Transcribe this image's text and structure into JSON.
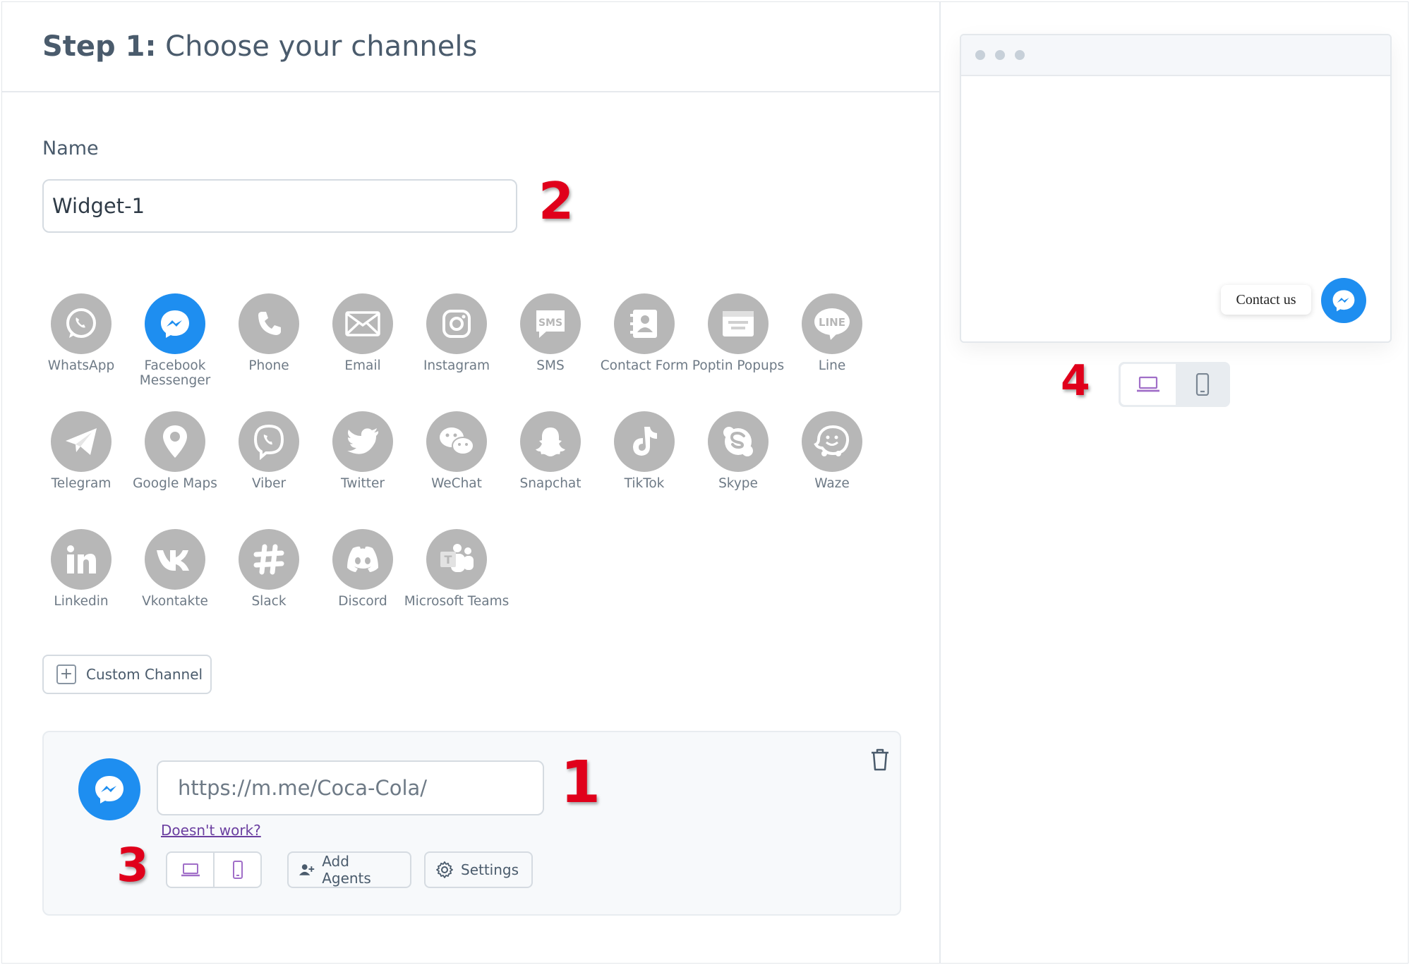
{
  "header": {
    "step_label": "Step 1:",
    "title": "Choose your channels"
  },
  "name_field": {
    "label": "Name",
    "value": "Widget-1"
  },
  "channels": [
    {
      "label": "WhatsApp",
      "icon": "whatsapp-icon"
    },
    {
      "label": "Facebook Messenger",
      "icon": "messenger-icon",
      "selected": true
    },
    {
      "label": "Phone",
      "icon": "phone-icon"
    },
    {
      "label": "Email",
      "icon": "email-icon"
    },
    {
      "label": "Instagram",
      "icon": "instagram-icon"
    },
    {
      "label": "SMS",
      "icon": "sms-icon"
    },
    {
      "label": "Contact Form",
      "icon": "contact-form-icon"
    },
    {
      "label": "Poptin Popups",
      "icon": "poptin-icon"
    },
    {
      "label": "Line",
      "icon": "line-icon"
    },
    {
      "label": "Telegram",
      "icon": "telegram-icon"
    },
    {
      "label": "Google Maps",
      "icon": "map-pin-icon"
    },
    {
      "label": "Viber",
      "icon": "viber-icon"
    },
    {
      "label": "Twitter",
      "icon": "twitter-icon"
    },
    {
      "label": "WeChat",
      "icon": "wechat-icon"
    },
    {
      "label": "Snapchat",
      "icon": "snapchat-icon"
    },
    {
      "label": "TikTok",
      "icon": "tiktok-icon"
    },
    {
      "label": "Skype",
      "icon": "skype-icon"
    },
    {
      "label": "Waze",
      "icon": "waze-icon"
    },
    {
      "label": "Linkedin",
      "icon": "linkedin-icon"
    },
    {
      "label": "Vkontakte",
      "icon": "vk-icon"
    },
    {
      "label": "Slack",
      "icon": "slack-icon"
    },
    {
      "label": "Discord",
      "icon": "discord-icon"
    },
    {
      "label": "Microsoft Teams",
      "icon": "teams-icon"
    }
  ],
  "custom_channel": {
    "label": "Custom Channel"
  },
  "config": {
    "url_placeholder": "https://m.me/Coca-Cola/",
    "help_link": "Doesn't work?",
    "add_agents": "Add Agents",
    "settings": "Settings"
  },
  "preview": {
    "contact_label": "Contact us"
  },
  "annotations": {
    "m1": "1",
    "m2": "2",
    "m3": "3",
    "m4": "4"
  },
  "colors": {
    "accent": "#1e8ef0",
    "inactive": "#b7b7b7",
    "marker": "#e0001b",
    "device_icon": "#a06ec8"
  }
}
